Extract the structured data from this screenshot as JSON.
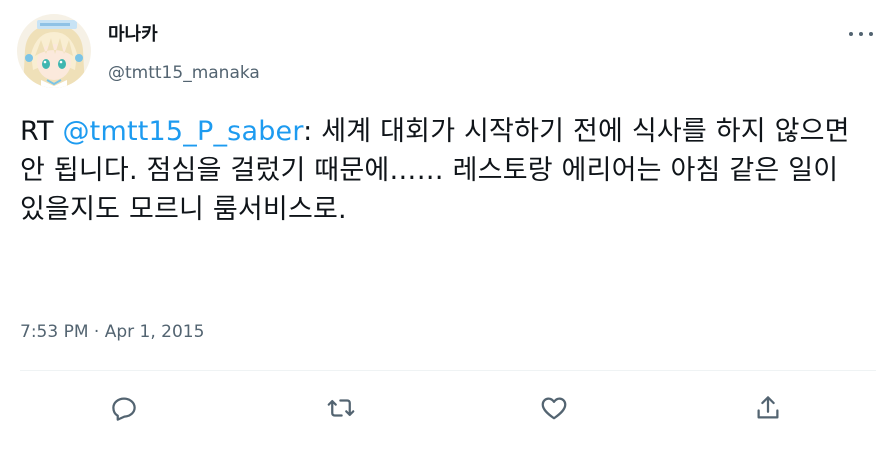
{
  "tweet": {
    "author": {
      "display_name": "마나카",
      "handle": "@tmtt15_manaka"
    },
    "text": {
      "prefix": "RT ",
      "mention": "@tmtt15_P_saber",
      "rest": ": 세계 대회가 시작하기 전에 식사를 하지 않으면 안 됩니다. 점심을 걸렀기 때문에…… 레스토랑 에리어는 아침 같은 일이 있을지도 모르니 룸서비스로."
    },
    "timestamp": "7:53 PM · Apr 1, 2015",
    "actions": {
      "reply_icon": "reply-icon",
      "retweet_icon": "retweet-icon",
      "like_icon": "heart-icon",
      "share_icon": "share-icon"
    },
    "colors": {
      "accent": "#1d9bf0",
      "secondary_text": "#536471",
      "primary_text": "#0f1419",
      "divider": "#eff3f4"
    }
  }
}
